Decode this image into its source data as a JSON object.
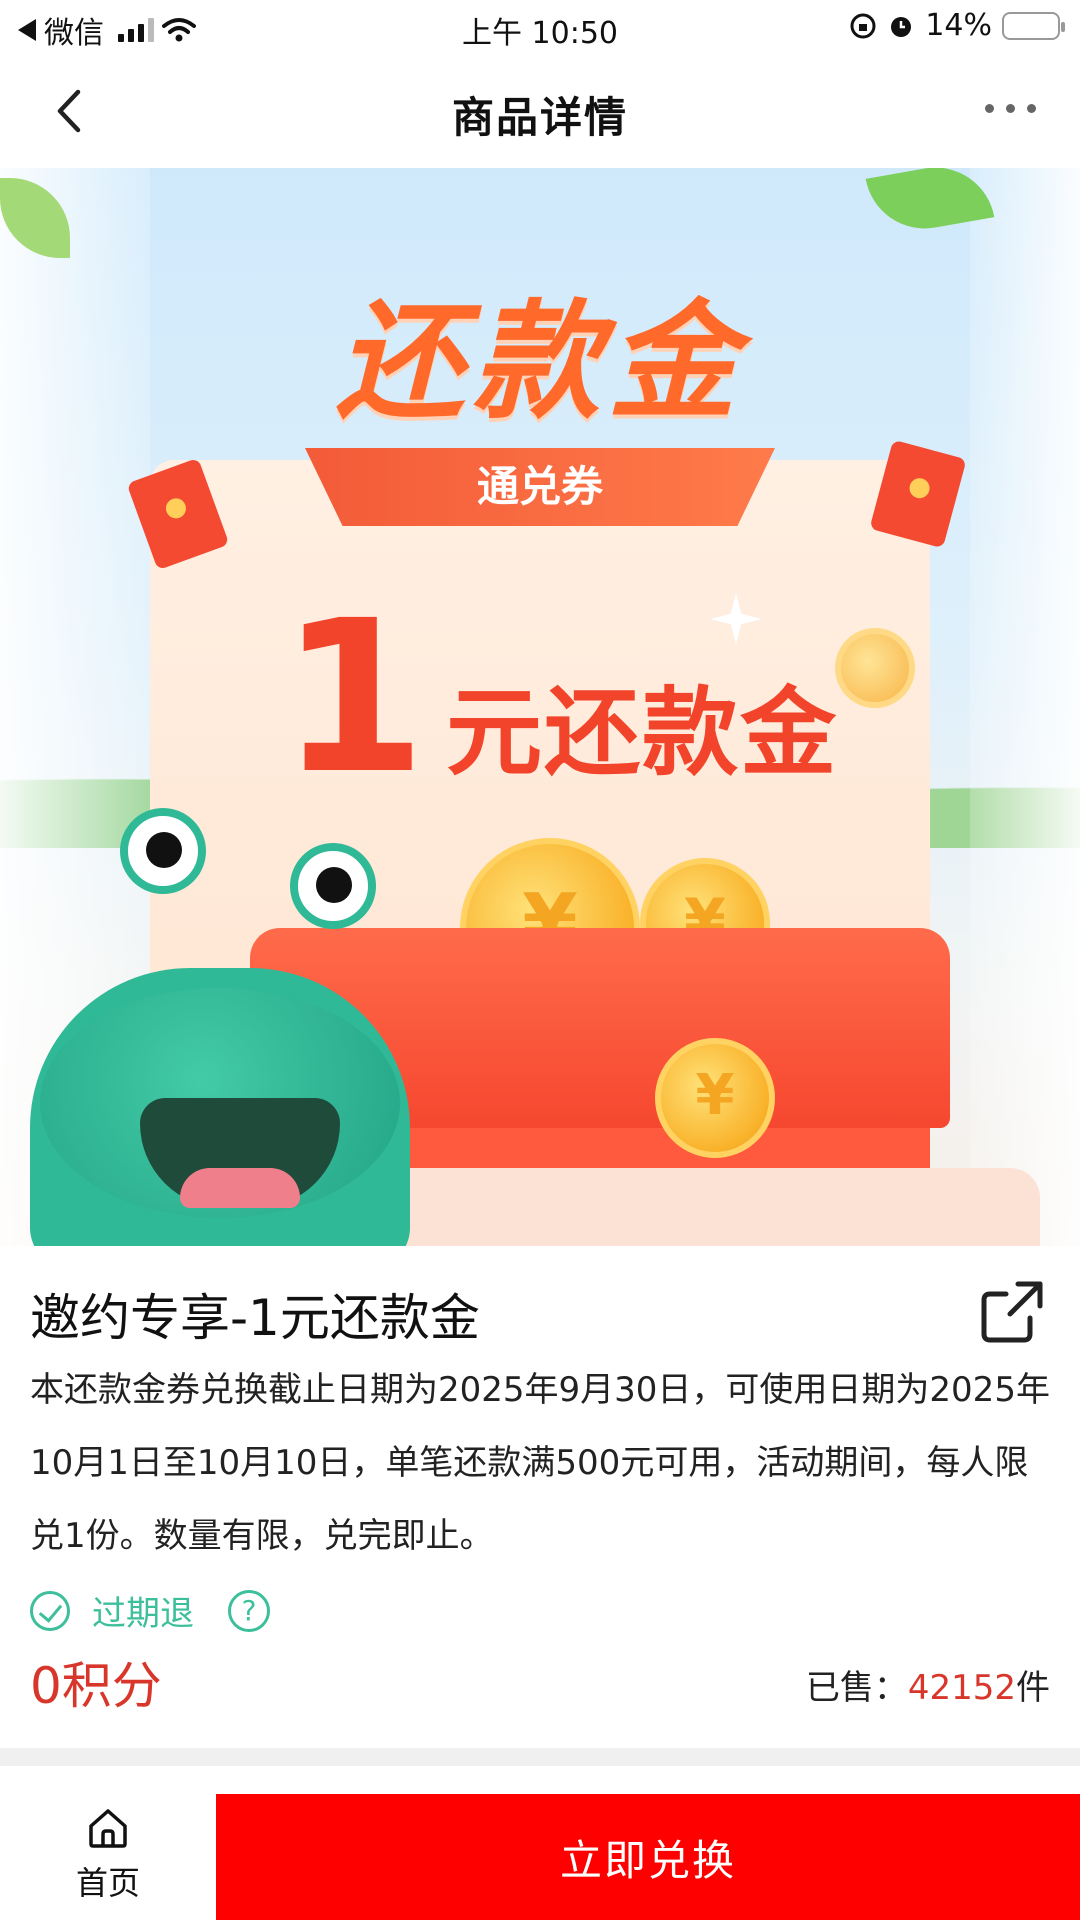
{
  "status_bar": {
    "app": "微信",
    "time": "上午 10:50",
    "battery": "14%",
    "battery_level": 0.14
  },
  "nav": {
    "title": "商品详情"
  },
  "banner": {
    "headline": "还款金",
    "ribbon": "通兑券",
    "amount_number": "1",
    "amount_unit": "元还款金",
    "coin_symbol": "¥"
  },
  "product": {
    "title": "邀约专享-1元还款金",
    "description": "本还款金券兑换截止日期为2025年9月30日，可使用日期为2025年10月1日至10月10日，单笔还款满500元可用，活动期间，每人限兑1份。数量有限，兑完即止。",
    "tag": "过期退",
    "tag_help": "?",
    "price": "0积分",
    "sold_label": "已售：",
    "sold_count": "42152",
    "sold_unit": "件"
  },
  "bottom_bar": {
    "home_label": "首页",
    "exchange_label": "立即兑换"
  },
  "colors": {
    "accent_red": "#ff0000",
    "price_red": "#d9362b",
    "tag_green": "#3cbf9a"
  }
}
